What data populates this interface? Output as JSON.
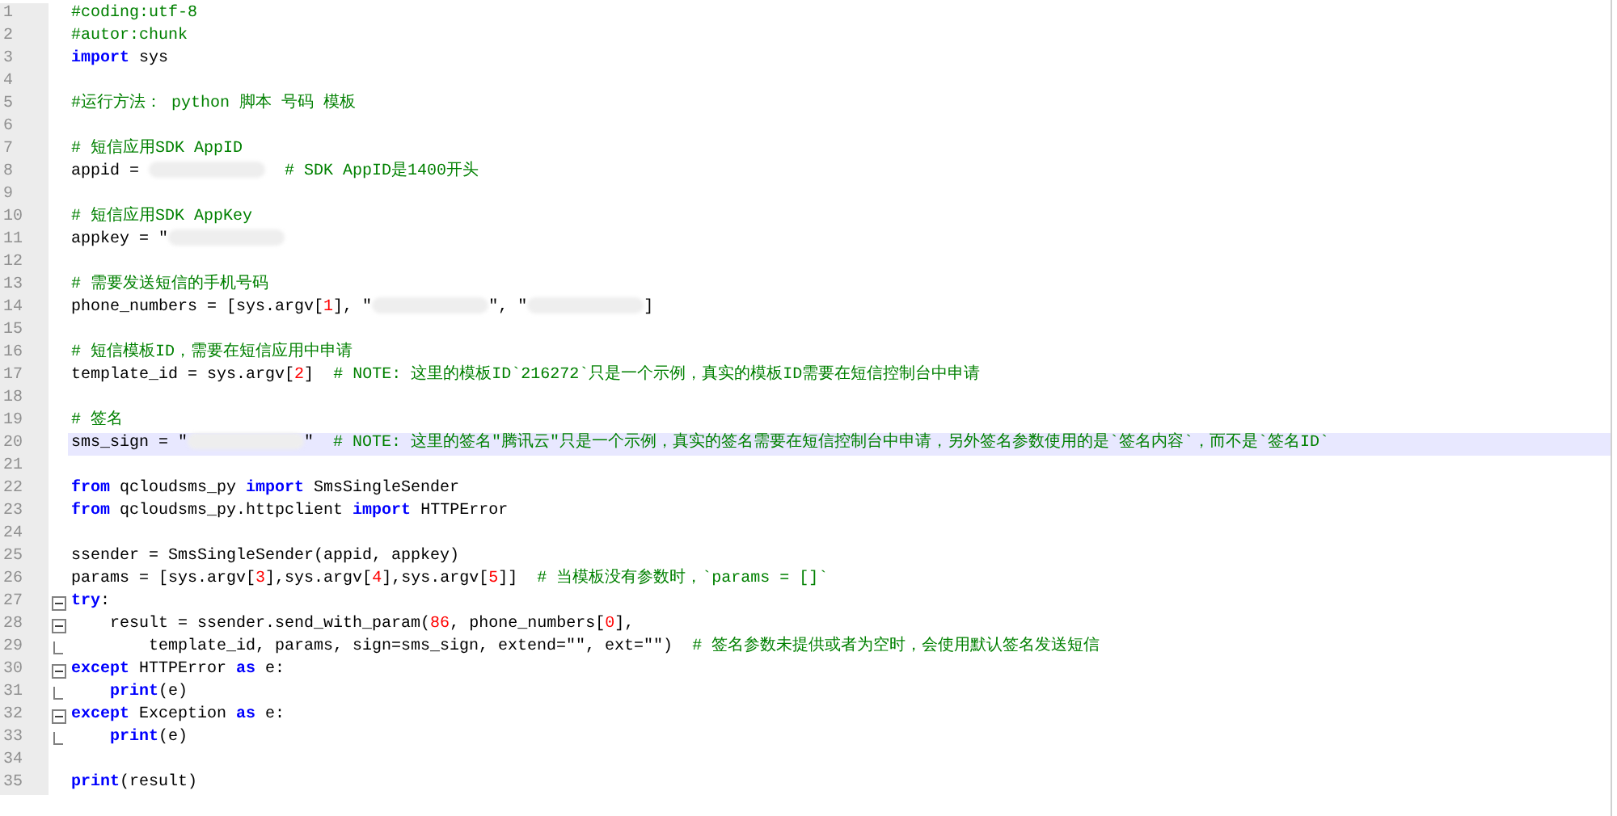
{
  "lines": [
    {
      "n": "1",
      "current": false,
      "tokens": [
        {
          "kind": "comment",
          "t": "#coding:utf-8"
        }
      ]
    },
    {
      "n": "2",
      "current": false,
      "tokens": [
        {
          "kind": "comment",
          "t": "#autor:chunk"
        }
      ]
    },
    {
      "n": "3",
      "current": false,
      "tokens": [
        {
          "kind": "keyword",
          "t": "import"
        },
        {
          "kind": "text",
          "t": " sys"
        }
      ]
    },
    {
      "n": "4",
      "current": false
    },
    {
      "n": "5",
      "current": false,
      "tokens": [
        {
          "kind": "comment",
          "t": "#运行方法： python 脚本 号码 模板"
        }
      ]
    },
    {
      "n": "6",
      "current": false
    },
    {
      "n": "7",
      "current": false,
      "tokens": [
        {
          "kind": "comment",
          "t": "# 短信应用SDK AppID"
        }
      ]
    },
    {
      "n": "8",
      "current": false,
      "tokens": [
        {
          "kind": "text",
          "t": "appid = "
        },
        {
          "kind": "redacted"
        },
        {
          "kind": "comment",
          "t": "  # SDK AppID是1400开头"
        }
      ]
    },
    {
      "n": "9",
      "current": false
    },
    {
      "n": "10",
      "current": false,
      "tokens": [
        {
          "kind": "comment",
          "t": "# 短信应用SDK AppKey"
        }
      ]
    },
    {
      "n": "11",
      "current": false,
      "tokens": [
        {
          "kind": "text",
          "t": "appkey = \""
        },
        {
          "kind": "redacted"
        }
      ]
    },
    {
      "n": "12",
      "current": false
    },
    {
      "n": "13",
      "current": false,
      "tokens": [
        {
          "kind": "comment",
          "t": "# 需要发送短信的手机号码"
        }
      ]
    },
    {
      "n": "14",
      "current": false,
      "tokens": [
        {
          "kind": "text",
          "t": "phone_numbers = [sys.argv["
        },
        {
          "kind": "number",
          "t": "1"
        },
        {
          "kind": "text",
          "t": "], \""
        },
        {
          "kind": "redacted"
        },
        {
          "kind": "text",
          "t": "\", \""
        },
        {
          "kind": "redacted"
        },
        {
          "kind": "text",
          "t": "]"
        }
      ]
    },
    {
      "n": "15",
      "current": false
    },
    {
      "n": "16",
      "current": false,
      "tokens": [
        {
          "kind": "comment",
          "t": "# 短信模板ID，需要在短信应用中申请"
        }
      ]
    },
    {
      "n": "17",
      "current": false,
      "tokens": [
        {
          "kind": "text",
          "t": "template_id = sys.argv["
        },
        {
          "kind": "number",
          "t": "2"
        },
        {
          "kind": "text",
          "t": "]  "
        },
        {
          "kind": "comment",
          "t": "# NOTE: 这里的模板ID`216272`只是一个示例，真实的模板ID需要在短信控制台中申请"
        }
      ]
    },
    {
      "n": "18",
      "current": false
    },
    {
      "n": "19",
      "current": false,
      "tokens": [
        {
          "kind": "comment",
          "t": "# 签名"
        }
      ]
    },
    {
      "n": "20",
      "current": true,
      "tokens": [
        {
          "kind": "text",
          "t": "sms_sign = \""
        },
        {
          "kind": "redacted"
        },
        {
          "kind": "text",
          "t": "\"  "
        },
        {
          "kind": "comment",
          "t": "# NOTE: 这里的签名\"腾讯云\"只是一个示例，真实的签名需要在短信控制台中申请，另外签名参数使用的是`签名内容`，而不是`签名ID`"
        }
      ]
    },
    {
      "n": "21",
      "current": false
    },
    {
      "n": "22",
      "current": false,
      "tokens": [
        {
          "kind": "keyword",
          "t": "from"
        },
        {
          "kind": "text",
          "t": " qcloudsms_py "
        },
        {
          "kind": "keyword",
          "t": "import"
        },
        {
          "kind": "text",
          "t": " SmsSingleSender"
        }
      ]
    },
    {
      "n": "23",
      "current": false,
      "tokens": [
        {
          "kind": "keyword",
          "t": "from"
        },
        {
          "kind": "text",
          "t": " qcloudsms_py.httpclient "
        },
        {
          "kind": "keyword",
          "t": "import"
        },
        {
          "kind": "text",
          "t": " HTTPError"
        }
      ]
    },
    {
      "n": "24",
      "current": false
    },
    {
      "n": "25",
      "current": false,
      "tokens": [
        {
          "kind": "text",
          "t": "ssender = SmsSingleSender(appid, appkey)"
        }
      ]
    },
    {
      "n": "26",
      "current": false,
      "tokens": [
        {
          "kind": "text",
          "t": "params = [sys.argv["
        },
        {
          "kind": "number",
          "t": "3"
        },
        {
          "kind": "text",
          "t": "],sys.argv["
        },
        {
          "kind": "number",
          "t": "4"
        },
        {
          "kind": "text",
          "t": "],sys.argv["
        },
        {
          "kind": "number",
          "t": "5"
        },
        {
          "kind": "text",
          "t": "]]  "
        },
        {
          "kind": "comment",
          "t": "# 当模板没有参数时，`params = []`"
        }
      ]
    },
    {
      "n": "27",
      "current": false,
      "tokens": [
        {
          "kind": "keyword",
          "t": "try"
        },
        {
          "kind": "text",
          "t": ":"
        }
      ],
      "children": [
        {
          "n": "28",
          "current": false,
          "tokens": [
            {
              "kind": "text",
              "t": "result = ssender.send_with_param("
            },
            {
              "kind": "number",
              "t": "86"
            },
            {
              "kind": "text",
              "t": ", phone_numbers["
            },
            {
              "kind": "number",
              "t": "0"
            },
            {
              "kind": "text",
              "t": "],"
            }
          ],
          "children": [
            {
              "n": "29",
              "current": false,
              "tokens": [
                {
                  "kind": "text",
                  "t": "template_id, params, sign=sms_sign, extend=\"\", ext=\"\")  "
                },
                {
                  "kind": "comment",
                  "t": "# 签名参数未提供或者为空时，会使用默认签名发送短信"
                }
              ]
            }
          ]
        }
      ]
    },
    {
      "n": "30",
      "current": false,
      "tokens": [
        {
          "kind": "keyword",
          "t": "except"
        },
        {
          "kind": "text",
          "t": " HTTPError "
        },
        {
          "kind": "keyword",
          "t": "as"
        },
        {
          "kind": "text",
          "t": " e:"
        }
      ],
      "children": [
        {
          "n": "31",
          "current": false,
          "tokens": [
            {
              "kind": "keyword",
              "t": "print"
            },
            {
              "kind": "text",
              "t": "(e)"
            }
          ]
        }
      ]
    },
    {
      "n": "32",
      "current": false,
      "tokens": [
        {
          "kind": "keyword",
          "t": "except"
        },
        {
          "kind": "text",
          "t": " Exception "
        },
        {
          "kind": "keyword",
          "t": "as"
        },
        {
          "kind": "text",
          "t": " e:"
        }
      ],
      "children": [
        {
          "n": "33",
          "current": false,
          "tokens": [
            {
              "kind": "keyword",
              "t": "print"
            },
            {
              "kind": "text",
              "t": "(e)"
            }
          ]
        }
      ]
    },
    {
      "n": "34",
      "current": false
    },
    {
      "n": "35",
      "current": false,
      "tokens": [
        {
          "kind": "keyword",
          "t": "print"
        },
        {
          "kind": "text",
          "t": "(result)"
        }
      ]
    }
  ]
}
